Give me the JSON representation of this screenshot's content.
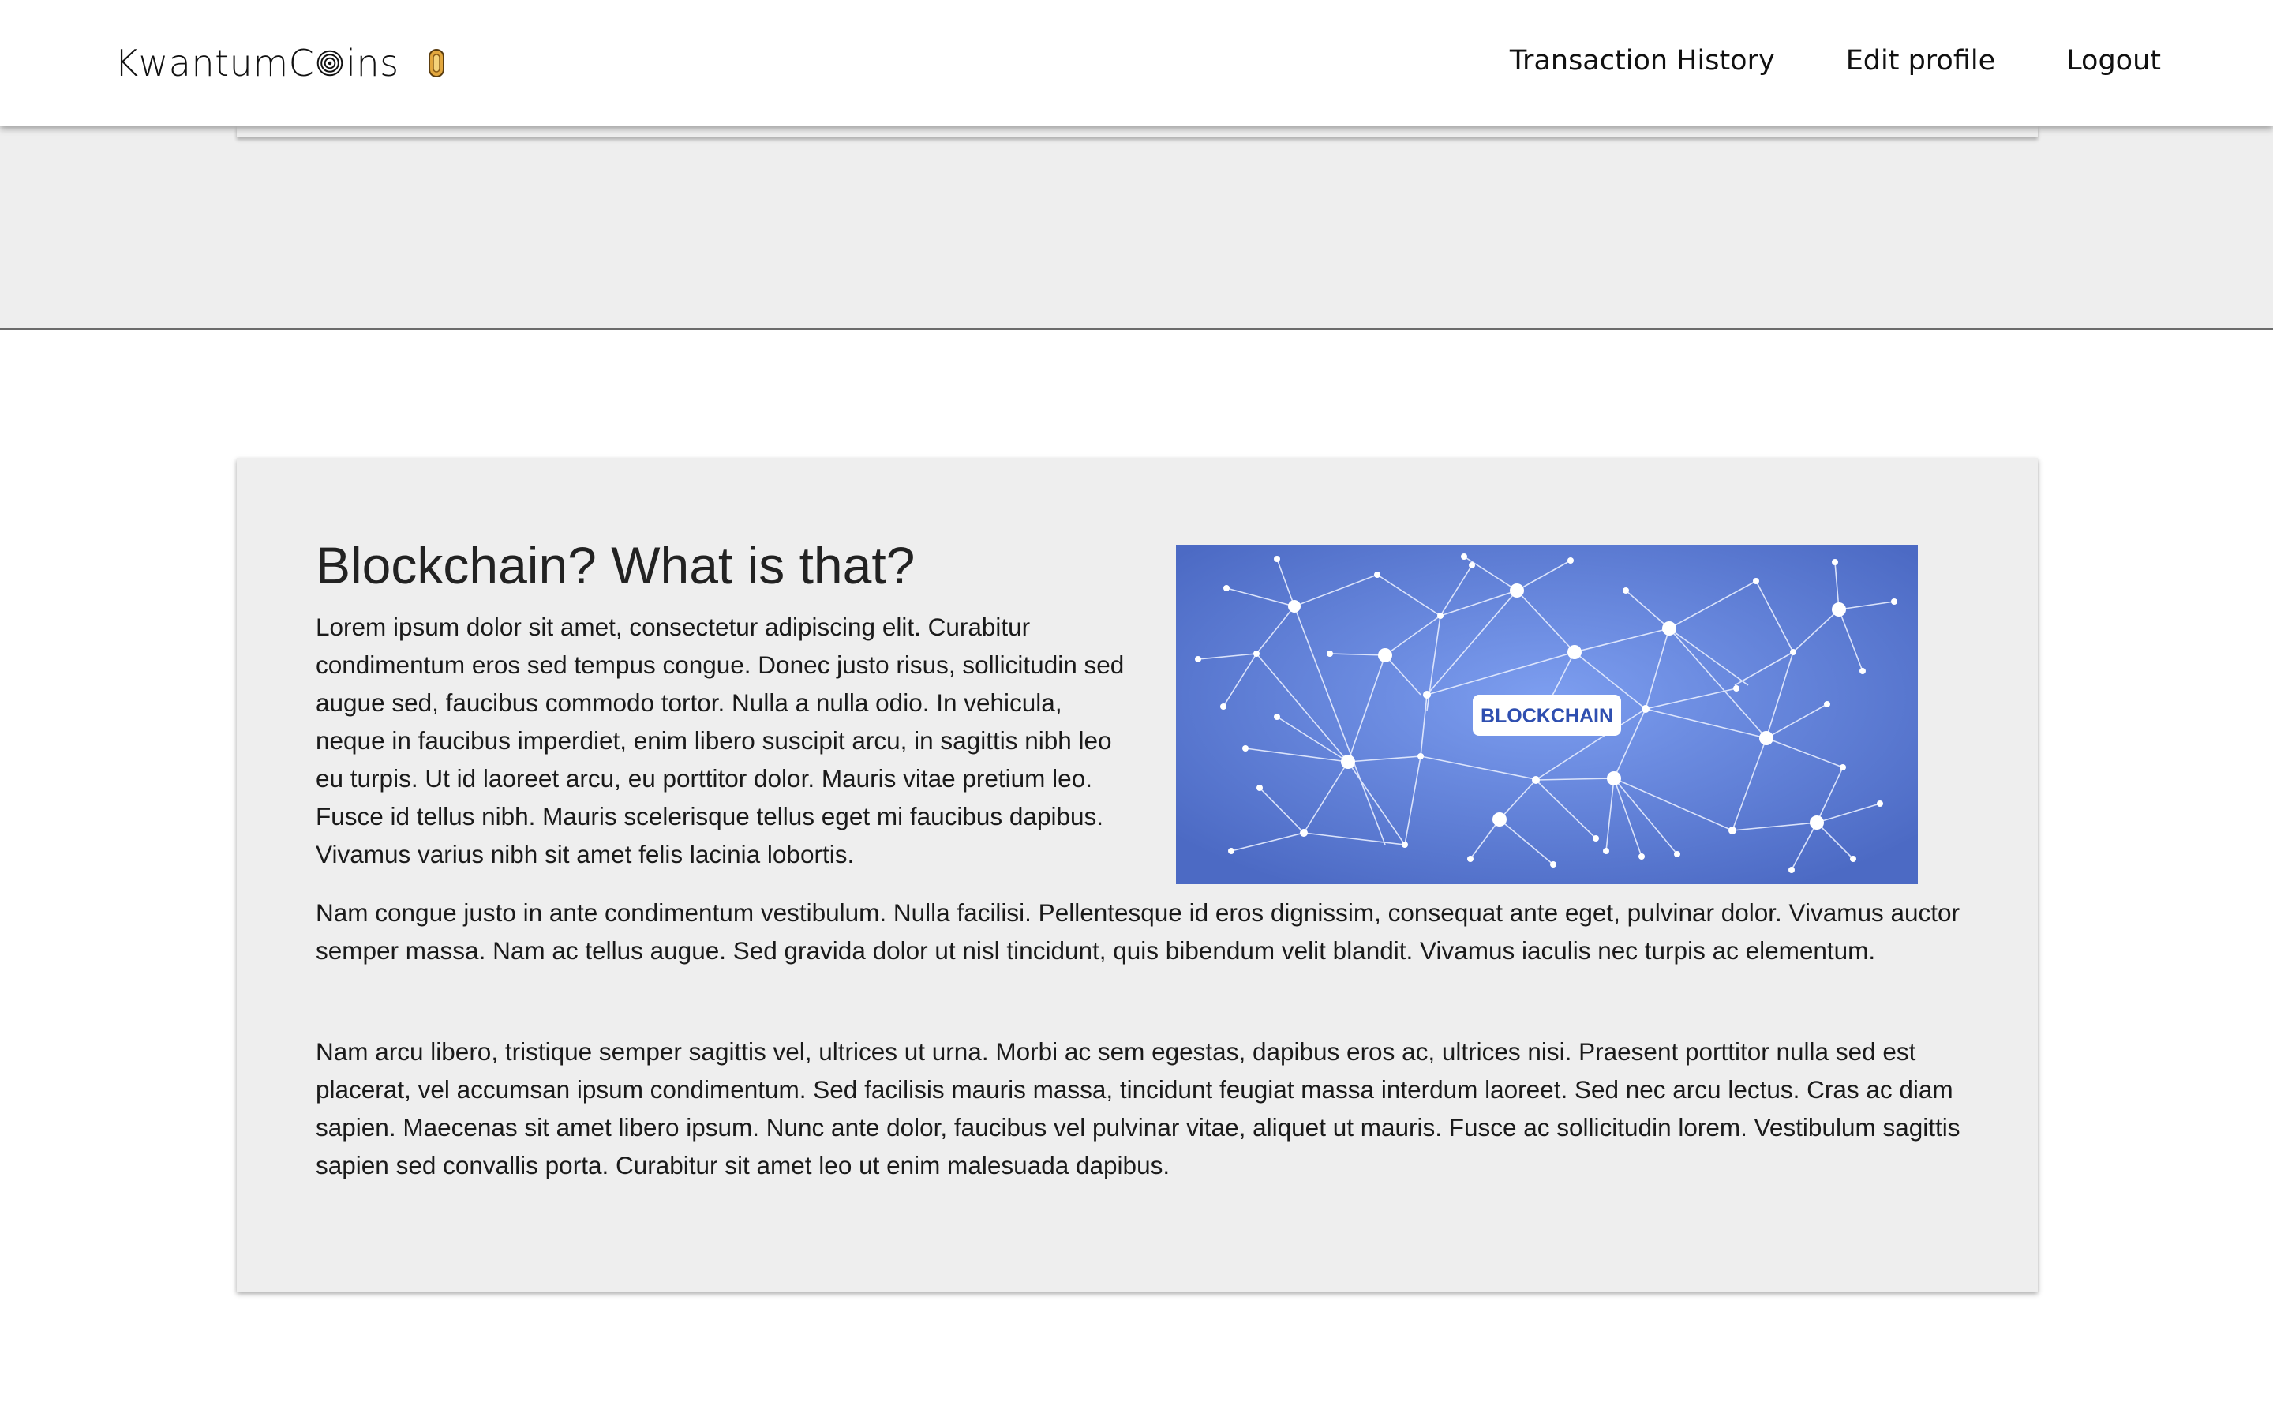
{
  "header": {
    "brand_prefix": "KwantumC",
    "brand_suffix": "ins",
    "brand_icon": "target-icon",
    "coin_icon": "coin-icon",
    "nav": [
      {
        "label": "Transaction History"
      },
      {
        "label": "Edit profile"
      },
      {
        "label": "Logout"
      }
    ]
  },
  "article": {
    "title": "Blockchain? What is that?",
    "paragraphs": [
      "Lorem ipsum dolor sit amet, consectetur adipiscing elit. Curabitur condimentum eros sed tempus congue. Donec justo risus, sollicitudin sed augue sed, faucibus commodo tortor. Nulla a nulla odio. In vehicula, neque in faucibus imperdiet, enim libero suscipit arcu, in sagittis nibh leo eu turpis. Ut id laoreet arcu, eu porttitor dolor. Mauris vitae pretium leo. Fusce id tellus nibh. Mauris scelerisque tellus eget mi faucibus dapibus. Vivamus varius nibh sit amet felis lacinia lobortis.",
      "Nam congue justo in ante condimentum vestibulum. Nulla facilisi. Pellentesque id eros dignissim, consequat ante eget, pulvinar dolor. Vivamus auctor semper massa. Nam ac tellus augue. Sed gravida dolor ut nisl tincidunt, quis bibendum velit blandit. Vivamus iaculis nec turpis ac elementum.",
      "Nam arcu libero, tristique semper sagittis vel, ultrices ut urna. Morbi ac sem egestas, dapibus eros ac, ultrices nisi. Praesent porttitor nulla sed est placerat, vel accumsan ipsum condimentum. Sed facilisis mauris massa, tincidunt feugiat massa interdum laoreet. Sed nec arcu lectus. Cras ac diam sapien. Maecenas sit amet libero ipsum. Nunc ante dolor, faucibus vel pulvinar vitae, aliquet ut mauris. Fusce ac sollicitudin lorem. Vestibulum sagittis sapien sed convallis porta. Curabitur sit amet leo ut enim malesuada dapibus."
    ],
    "image": {
      "label": "BLOCKCHAIN",
      "bg_color": "#5b7fd8",
      "label_color": "#2f4fb0"
    }
  },
  "colors": {
    "page_bg": "#ffffff",
    "band_bg": "#eeeeee",
    "card_bg": "#eeeeee",
    "text": "#1a1a1a"
  }
}
